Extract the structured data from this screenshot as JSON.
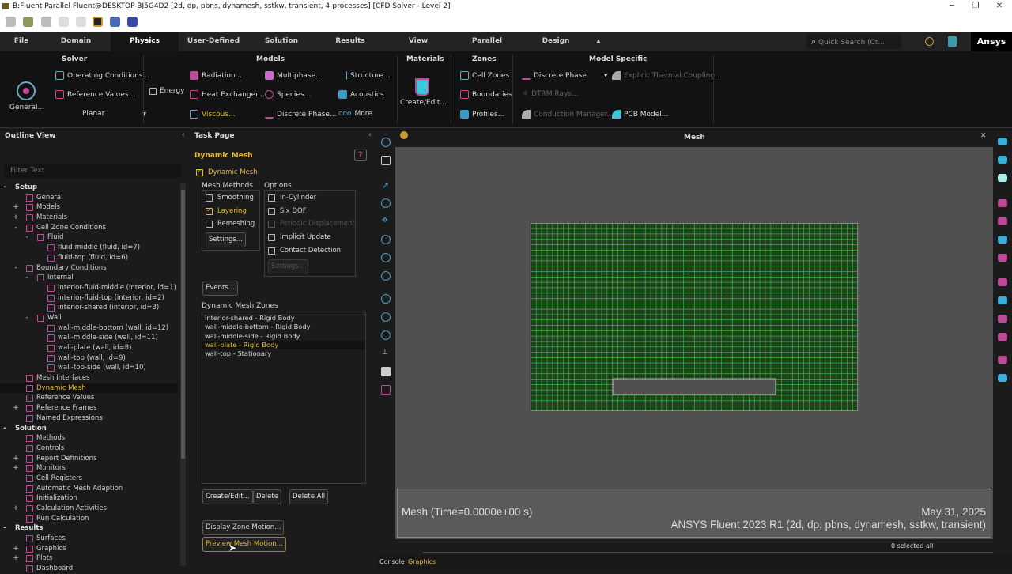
{
  "window": {
    "title": "B:Fluent Parallel Fluent@DESKTOP-BJ5G4D2  [2d, dp, pbns, dynamesh, sstkw, transient, 4-processes] [CFD Solver - Level 2]",
    "min": "─",
    "max": "❐",
    "close": "✕"
  },
  "menu": {
    "tabs": [
      "File",
      "Domain",
      "Physics",
      "User-Defined",
      "Solution",
      "Results",
      "View",
      "Parallel",
      "Design"
    ],
    "active": "Physics",
    "collapse": "▲",
    "search_placeholder": "Quick Search (Ct...",
    "brand": "Ansys"
  },
  "ribbon": {
    "solver": {
      "title": "Solver",
      "general": "General...",
      "operating": "Operating Conditions...",
      "reference": "Reference Values...",
      "planar": "Planar"
    },
    "models": {
      "title": "Models",
      "energy": "Energy",
      "radiation": "Radiation...",
      "heat_exchanger": "Heat Exchanger...",
      "viscous": "Viscous...",
      "multiphase": "Multiphase...",
      "species": "Species...",
      "discrete_phase": "Discrete Phase...",
      "structure": "Structure...",
      "acoustics": "Acoustics",
      "more": "More"
    },
    "materials": {
      "title": "Materials",
      "create": "Create/Edit..."
    },
    "zones": {
      "title": "Zones",
      "cell": "Cell Zones",
      "boundaries": "Boundaries",
      "profiles": "Profiles..."
    },
    "model_specific": {
      "title": "Model Specific",
      "discrete_phase": "Discrete Phase",
      "explicit": "Explicit Thermal Coupling...",
      "dtrm": "DTRM Rays...",
      "conduction": "Conduction Manager...",
      "pcb": "PCB Model..."
    }
  },
  "outline": {
    "title": "Outline View",
    "filter_placeholder": "Filter Text",
    "items": [
      {
        "label": "Setup",
        "level": 0,
        "pm": "-",
        "hdr": true
      },
      {
        "label": "General",
        "level": 2
      },
      {
        "label": "Models",
        "level": 2,
        "pm": "+"
      },
      {
        "label": "Materials",
        "level": 2,
        "pm": "+"
      },
      {
        "label": "Cell Zone Conditions",
        "level": 2,
        "pm": "-"
      },
      {
        "label": "Fluid",
        "level": 3,
        "pm": "-"
      },
      {
        "label": "fluid-middle (fluid, id=7)",
        "level": 4
      },
      {
        "label": "fluid-top (fluid, id=6)",
        "level": 4
      },
      {
        "label": "Boundary Conditions",
        "level": 2,
        "pm": "-"
      },
      {
        "label": "Internal",
        "level": 3,
        "pm": "-"
      },
      {
        "label": "interior-fluid-middle (interior, id=1)",
        "level": 4
      },
      {
        "label": "interior-fluid-top (interior, id=2)",
        "level": 4
      },
      {
        "label": "interior-shared (interior, id=3)",
        "level": 4
      },
      {
        "label": "Wall",
        "level": 3,
        "pm": "-"
      },
      {
        "label": "wall-middle-bottom (wall, id=12)",
        "level": 4
      },
      {
        "label": "wall-middle-side (wall, id=11)",
        "level": 4
      },
      {
        "label": "wall-plate (wall, id=8)",
        "level": 4
      },
      {
        "label": "wall-top (wall, id=9)",
        "level": 4
      },
      {
        "label": "wall-top-side (wall, id=10)",
        "level": 4
      },
      {
        "label": "Mesh Interfaces",
        "level": 2
      },
      {
        "label": "Dynamic Mesh",
        "level": 2,
        "sel": true
      },
      {
        "label": "Reference Values",
        "level": 2
      },
      {
        "label": "Reference Frames",
        "level": 2,
        "pm": "+"
      },
      {
        "label": "Named Expressions",
        "level": 2
      },
      {
        "label": "Solution",
        "level": 0,
        "pm": "-",
        "hdr": true
      },
      {
        "label": "Methods",
        "level": 2
      },
      {
        "label": "Controls",
        "level": 2
      },
      {
        "label": "Report Definitions",
        "level": 2,
        "pm": "+"
      },
      {
        "label": "Monitors",
        "level": 2,
        "pm": "+"
      },
      {
        "label": "Cell Registers",
        "level": 2
      },
      {
        "label": "Automatic Mesh Adaption",
        "level": 2
      },
      {
        "label": "Initialization",
        "level": 2
      },
      {
        "label": "Calculation Activities",
        "level": 2,
        "pm": "+"
      },
      {
        "label": "Run Calculation",
        "level": 2
      },
      {
        "label": "Results",
        "level": 0,
        "pm": "-",
        "hdr": true
      },
      {
        "label": "Surfaces",
        "level": 2
      },
      {
        "label": "Graphics",
        "level": 2,
        "pm": "+"
      },
      {
        "label": "Plots",
        "level": 2,
        "pm": "+"
      },
      {
        "label": "Dashboard",
        "level": 2
      }
    ]
  },
  "task": {
    "title": "Task Page",
    "heading": "Dynamic Mesh",
    "help": "?",
    "dynamic_mesh": "Dynamic Mesh",
    "mesh_methods": "Mesh Methods",
    "smoothing": "Smoothing",
    "layering": "Layering",
    "remeshing": "Remeshing",
    "settings": "Settings...",
    "options": "Options",
    "in_cylinder": "In-Cylinder",
    "six_dof": "Six DOF",
    "periodic": "Periodic Displacement",
    "implicit": "Implicit Update",
    "contact": "Contact Detection",
    "events": "Events...",
    "zones_label": "Dynamic Mesh Zones",
    "zones": [
      "interior-shared - Rigid Body",
      "wall-middle-bottom - Rigid Body",
      "wall-middle-side - Rigid Body",
      "wall-plate - Rigid Body",
      "wall-top - Stationary"
    ],
    "create": "Create/Edit...",
    "delete": "Delete",
    "delete_all": "Delete All",
    "display_zone": "Display Zone Motion...",
    "preview": "Preview Mesh Motion..."
  },
  "graphics": {
    "title": "Mesh",
    "close": "✕",
    "legend_left": "Mesh  (Time=0.0000e+00 s)",
    "legend_date": "May 31, 2025",
    "legend_version": "ANSYS Fluent 2023 R1 (2d, dp, pbns, dynamesh, sstkw, transient)",
    "selection": "0 selected all",
    "selection_arrow": "▼"
  },
  "bottom": {
    "console": "Console",
    "graphics": "Graphics"
  },
  "colors": {
    "accent": "#e8b93a",
    "mesh_line": "#3fd13f",
    "mesh_bg": "#1f3f1f",
    "bg": "#1b1b1b"
  }
}
